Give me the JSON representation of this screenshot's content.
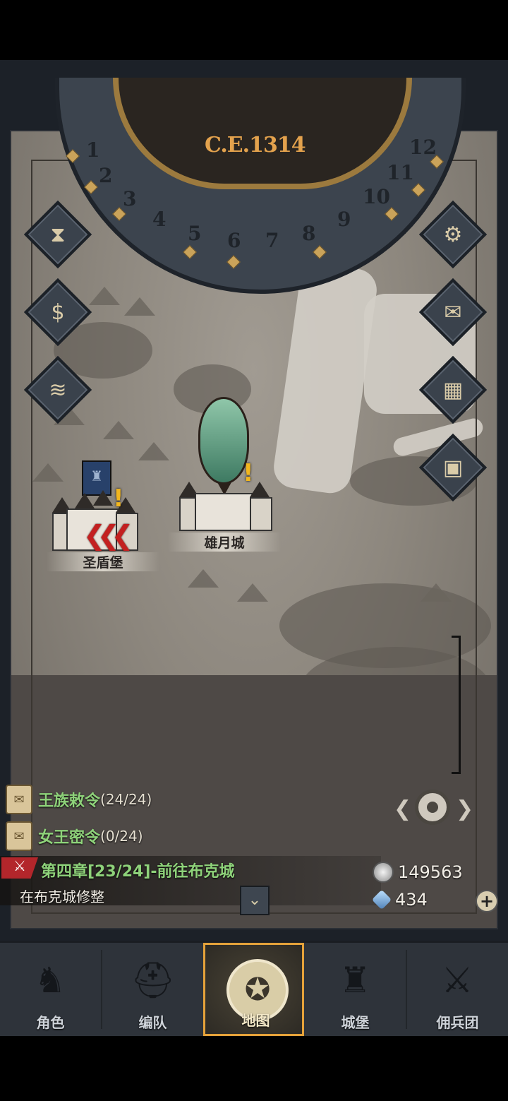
{
  "dial": {
    "year": "C.E.1314",
    "months": [
      "1",
      "2",
      "3",
      "4",
      "5",
      "6",
      "7",
      "8",
      "9",
      "10",
      "11",
      "12"
    ]
  },
  "left_buttons": [
    {
      "name": "hourglass-icon",
      "glyph": "⧗"
    },
    {
      "name": "money-bag-icon",
      "glyph": "$"
    },
    {
      "name": "scroll-icon",
      "glyph": "≋"
    }
  ],
  "right_buttons": [
    {
      "name": "gear-icon",
      "glyph": "⚙"
    },
    {
      "name": "envelope-icon",
      "glyph": "✉"
    },
    {
      "name": "building-icon",
      "glyph": "▦"
    },
    {
      "name": "supplies-icon",
      "glyph": "▣"
    }
  ],
  "castles": {
    "left": {
      "label": "圣盾堡"
    },
    "center": {
      "label": "雄月城"
    }
  },
  "quests": [
    {
      "name": "王族敕令",
      "count": "(24/24)"
    },
    {
      "name": "女王密令",
      "count": "(0/24)"
    }
  ],
  "chapter": {
    "title": "第四章[23/24]-前往布克城",
    "subtitle": "在布克城修整"
  },
  "resources": {
    "silver": "149563",
    "crystal": "434"
  },
  "tabs": [
    {
      "label": "角色",
      "icon": "knight-icon",
      "glyph": "♞"
    },
    {
      "label": "编队",
      "icon": "helmet-icon",
      "glyph": "⛑"
    },
    {
      "label": "地图",
      "icon": "world-map-icon",
      "glyph": "✪",
      "active": true
    },
    {
      "label": "城堡",
      "icon": "castle-icon",
      "glyph": "♜"
    },
    {
      "label": "佣兵团",
      "icon": "mercenary-icon",
      "glyph": "⚔"
    }
  ],
  "colors": {
    "accent_gold": "#e5a23a",
    "quest_green": "#8ed27a",
    "year_orange": "#e3a24d",
    "chapter_red": "#b3262b"
  }
}
